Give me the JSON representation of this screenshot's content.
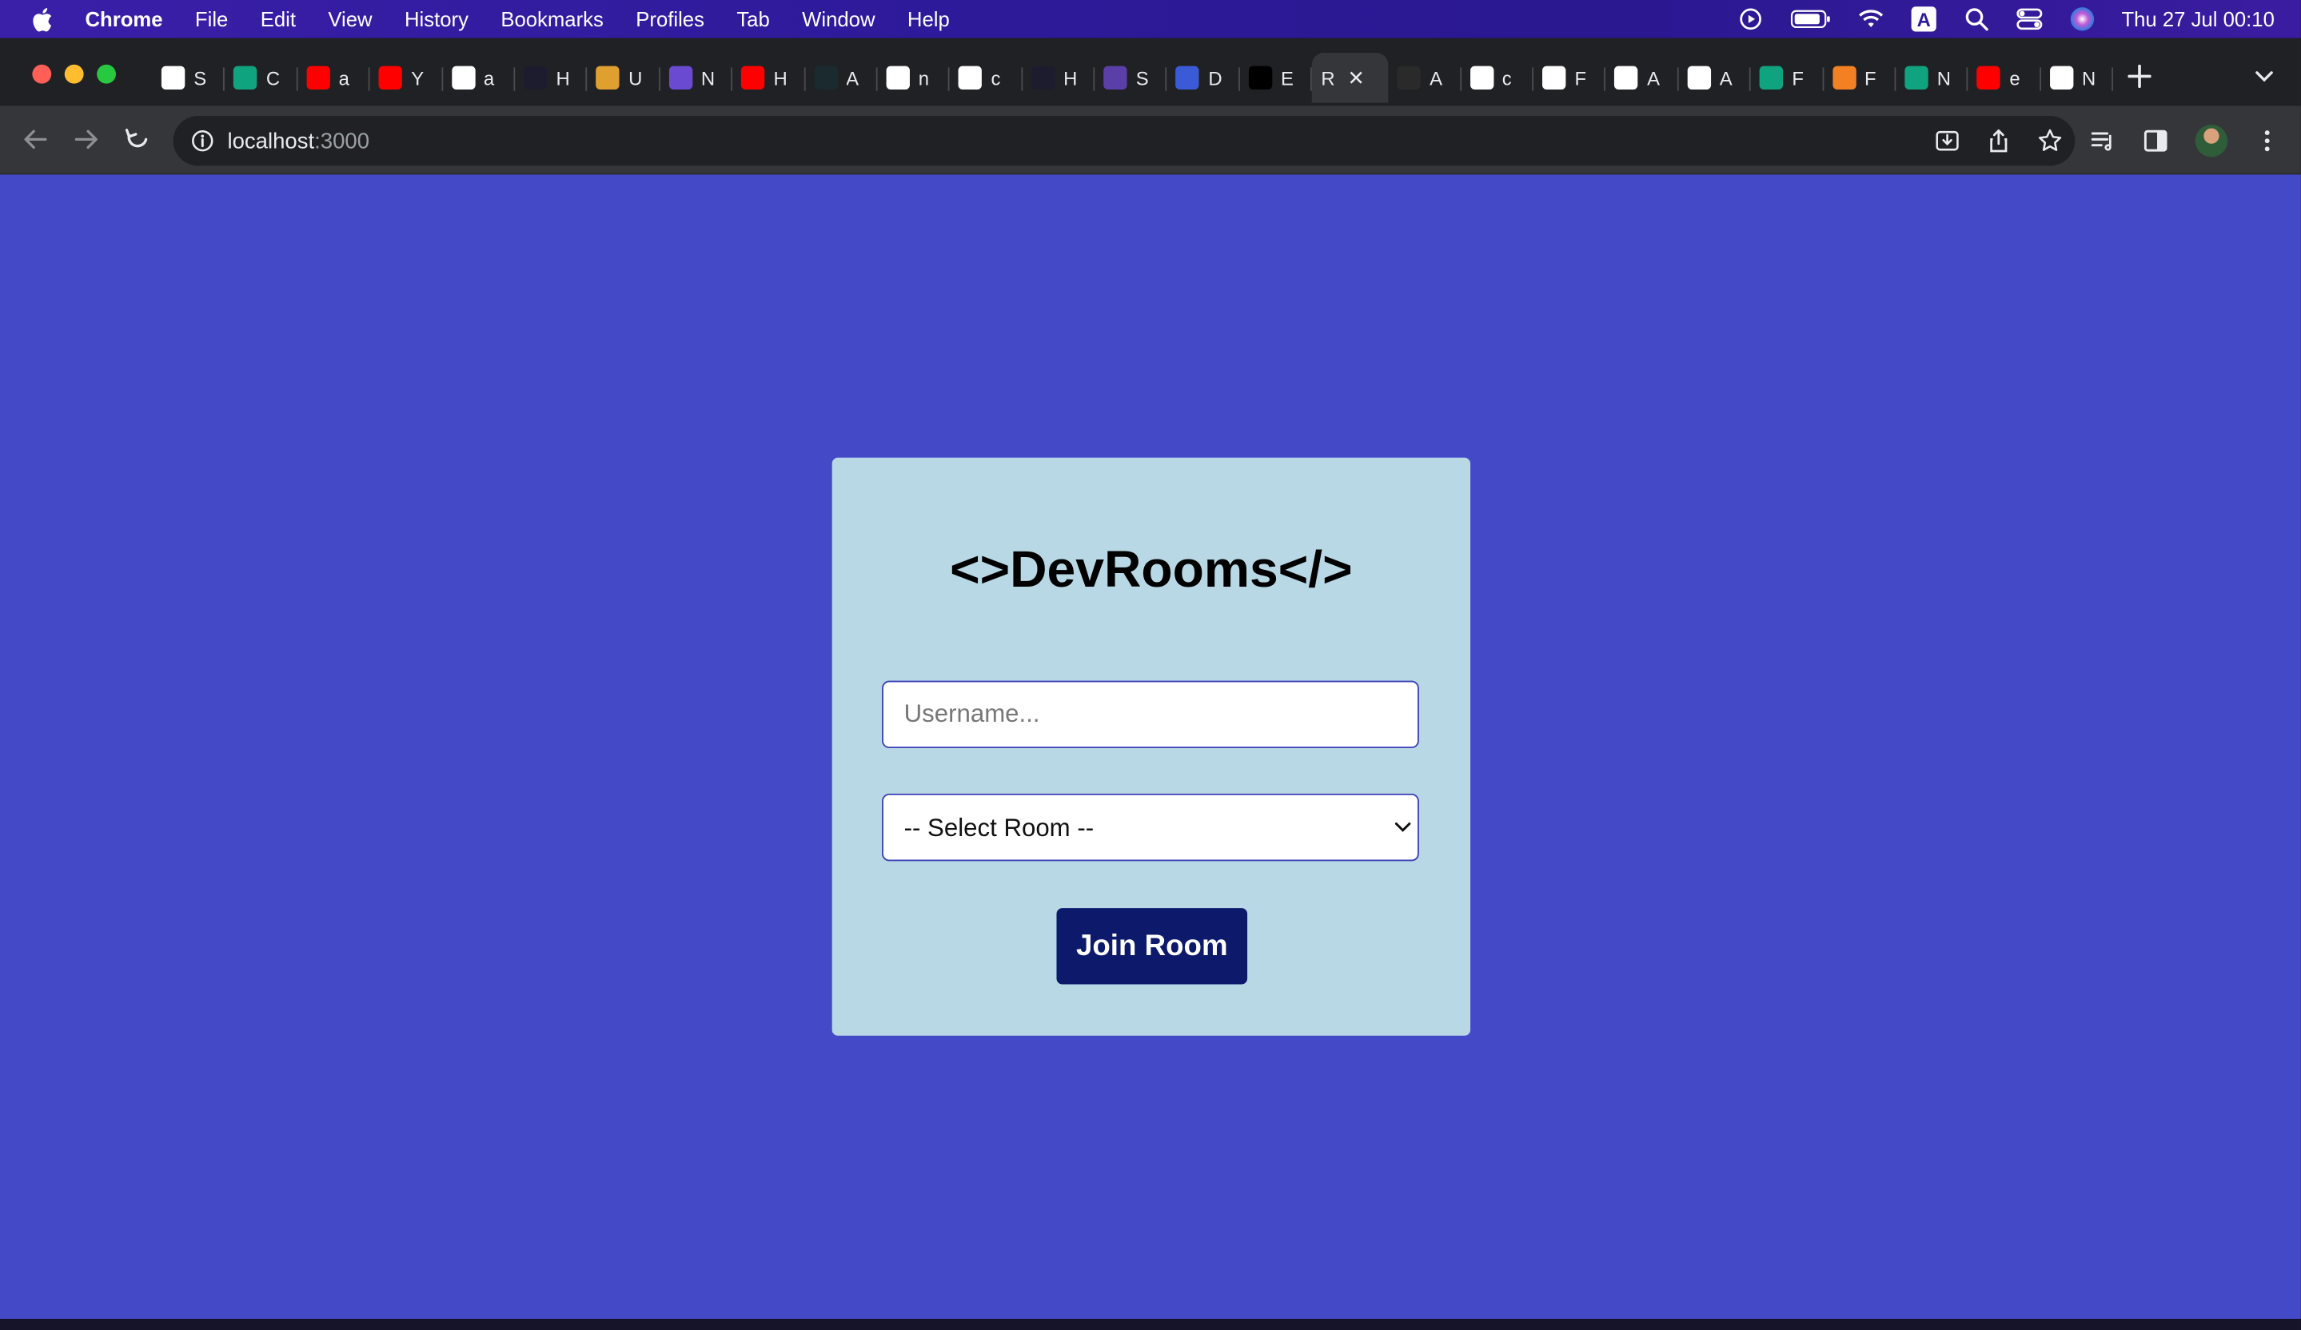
{
  "menubar": {
    "app_name": "Chrome",
    "items": [
      "File",
      "Edit",
      "View",
      "History",
      "Bookmarks",
      "Profiles",
      "Tab",
      "Window",
      "Help"
    ],
    "input_source": "A",
    "clock": "Thu 27 Jul  00:10"
  },
  "tabs": [
    {
      "icon": "gmail-icon",
      "title": "S",
      "color": "#ffffff"
    },
    {
      "icon": "chatgpt-icon",
      "title": "C",
      "color": "#10a37f"
    },
    {
      "icon": "youtube-icon",
      "title": "a",
      "color": "#ff0000"
    },
    {
      "icon": "youtube-icon",
      "title": "Y",
      "color": "#ff0000"
    },
    {
      "icon": "google-icon",
      "title": "a",
      "color": "#ffffff"
    },
    {
      "icon": "a-icon",
      "title": "H",
      "color": "#1c1c2e"
    },
    {
      "icon": "bars-icon",
      "title": "U",
      "color": "#e0a030"
    },
    {
      "icon": "figure-icon",
      "title": "N",
      "color": "#6a4ad0"
    },
    {
      "icon": "youtube-icon",
      "title": "H",
      "color": "#ff0000"
    },
    {
      "icon": "react-icon",
      "title": "A",
      "color": "#1b2a2f"
    },
    {
      "icon": "google-icon",
      "title": "n",
      "color": "#ffffff"
    },
    {
      "icon": "github-icon",
      "title": "c",
      "color": "#ffffff"
    },
    {
      "icon": "a-icon",
      "title": "H",
      "color": "#1c1c2e"
    },
    {
      "icon": "purple-icon",
      "title": "S",
      "color": "#5b3fa8"
    },
    {
      "icon": "layers-icon",
      "title": "D",
      "color": "#3b5bd6"
    },
    {
      "icon": "medium-icon",
      "title": "E",
      "color": "#000000"
    },
    {
      "icon": "none",
      "title": "R",
      "color": "#35363a",
      "active": true
    },
    {
      "icon": "github-dark-icon",
      "title": "A",
      "color": "#2a2a2a"
    },
    {
      "icon": "google-icon",
      "title": "c",
      "color": "#ffffff"
    },
    {
      "icon": "github-icon",
      "title": "F",
      "color": "#ffffff"
    },
    {
      "icon": "github-icon",
      "title": "A",
      "color": "#ffffff"
    },
    {
      "icon": "github-icon",
      "title": "A",
      "color": "#ffffff"
    },
    {
      "icon": "chatgpt-icon",
      "title": "F",
      "color": "#10a37f"
    },
    {
      "icon": "stackoverflow-icon",
      "title": "F",
      "color": "#f48024"
    },
    {
      "icon": "chatgpt-icon",
      "title": "N",
      "color": "#10a37f"
    },
    {
      "icon": "youtube-icon",
      "title": "e",
      "color": "#ff0000"
    },
    {
      "icon": "chrome-icon",
      "title": "N",
      "color": "#ffffff"
    }
  ],
  "omnibox": {
    "host": "localhost",
    "port": ":3000"
  },
  "page": {
    "background": "#4349c7",
    "card_background": "#b7d8e4",
    "title": "<>DevRooms</>",
    "username_placeholder": "Username...",
    "username_value": "",
    "room_select_value": "-- Select Room --",
    "join_button": "Join Room",
    "join_button_color": "#0d1a6b"
  }
}
